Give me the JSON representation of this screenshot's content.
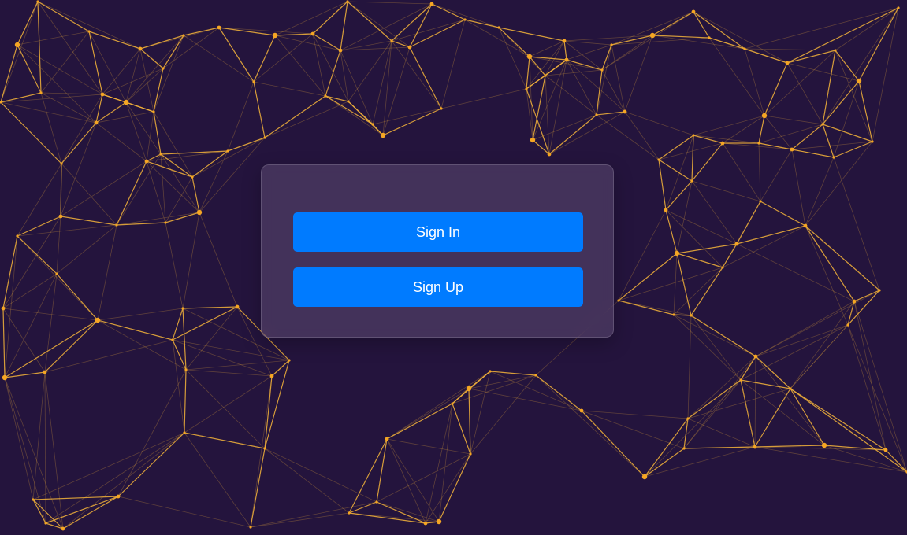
{
  "background": {
    "color": "#24143d",
    "line_color": "#f5b43a",
    "node_color": "#f5a623"
  },
  "auth": {
    "sign_in_label": "Sign In",
    "sign_up_label": "Sign Up",
    "button_color": "#007bff"
  }
}
